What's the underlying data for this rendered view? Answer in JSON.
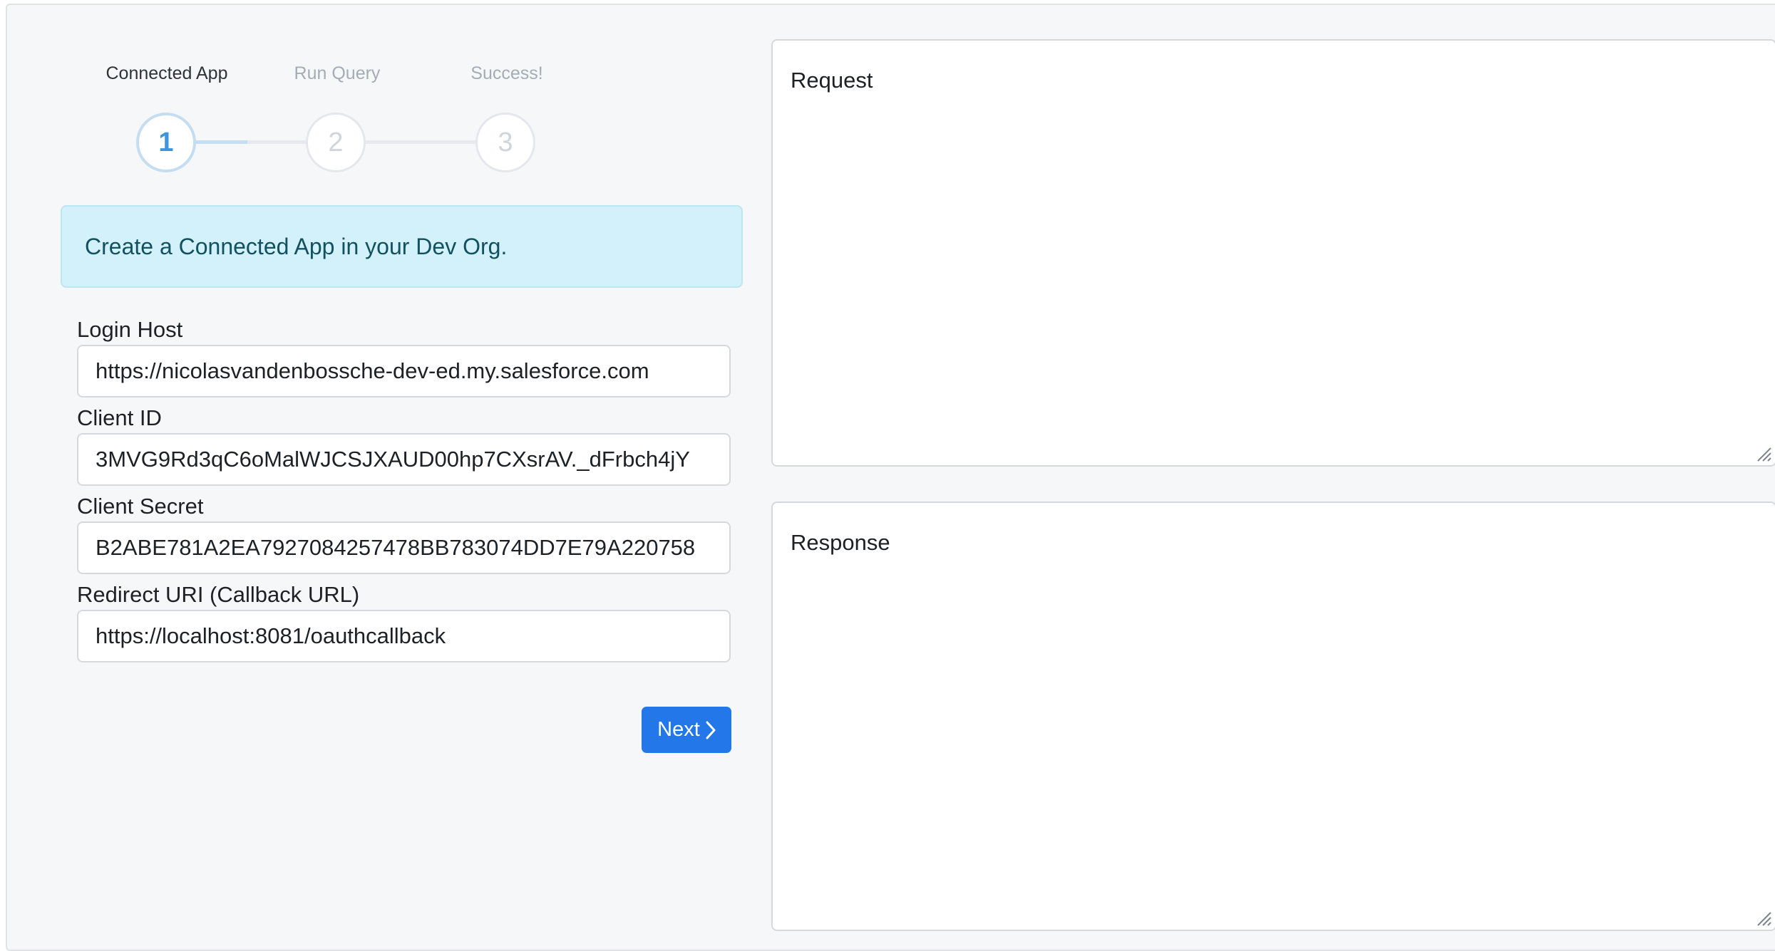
{
  "stepper": {
    "steps": [
      {
        "label": "Connected App",
        "number": "1",
        "state": "active"
      },
      {
        "label": "Run Query",
        "number": "2",
        "state": "inactive"
      },
      {
        "label": "Success!",
        "number": "3",
        "state": "inactive"
      }
    ]
  },
  "alert": {
    "text": "Create a Connected App in your Dev Org."
  },
  "form": {
    "login_host": {
      "label": "Login Host",
      "value": "https://nicolasvandenbossche-dev-ed.my.salesforce.com"
    },
    "client_id": {
      "label": "Client ID",
      "value": "3MVG9Rd3qC6oMalWJCSJXAUD00hp7CXsrAV._dFrbch4jY"
    },
    "client_secret": {
      "label": "Client Secret",
      "value": "B2ABE781A2EA7927084257478BB783074DD7E79A220758"
    },
    "redirect_uri": {
      "label": "Redirect URI (Callback URL)",
      "value": "https://localhost:8081/oauthcallback"
    },
    "next_button_label": "Next"
  },
  "panels": {
    "request": {
      "text": "Request"
    },
    "response": {
      "text": "Response"
    }
  },
  "colors": {
    "primary_button": "#2377e8",
    "alert_bg": "#d3f1fa",
    "alert_text": "#12515f",
    "active_step": "#3c95dd"
  },
  "icons": {
    "next": "chevron-right-icon",
    "resize": "resize-grip-icon"
  }
}
